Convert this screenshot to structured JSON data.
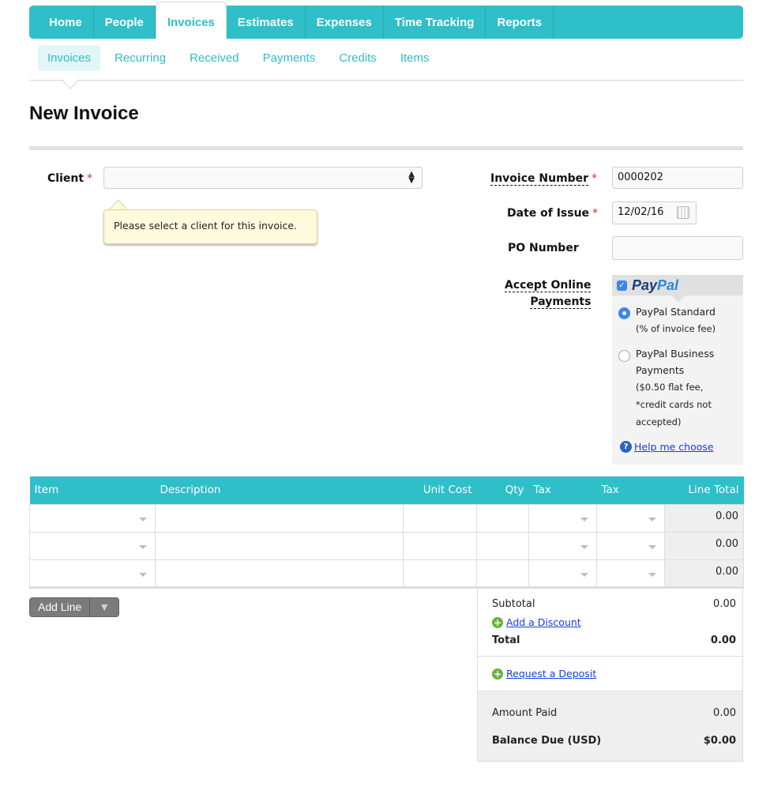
{
  "nav": {
    "tabs": [
      {
        "label": "Home",
        "active": false
      },
      {
        "label": "People",
        "active": false
      },
      {
        "label": "Invoices",
        "active": true
      },
      {
        "label": "Estimates",
        "active": false
      },
      {
        "label": "Expenses",
        "active": false
      },
      {
        "label": "Time Tracking",
        "active": false
      },
      {
        "label": "Reports",
        "active": false
      }
    ],
    "subtabs": [
      {
        "label": "Invoices",
        "active": true
      },
      {
        "label": "Recurring",
        "active": false
      },
      {
        "label": "Received",
        "active": false
      },
      {
        "label": "Payments",
        "active": false
      },
      {
        "label": "Credits",
        "active": false
      },
      {
        "label": "Items",
        "active": false
      }
    ]
  },
  "page": {
    "title": "New Invoice"
  },
  "form": {
    "client_label": "Client",
    "required_mark": "*",
    "client_value": "",
    "client_tooltip": "Please select a client for this invoice.",
    "invoice_number_label": "Invoice Number",
    "invoice_number_value": "0000202",
    "date_label": "Date of Issue",
    "date_value": "12/02/16",
    "po_label": "PO Number",
    "po_value": "",
    "online_label_1": "Accept Online",
    "online_label_2": "Payments"
  },
  "paypal": {
    "checked": true,
    "logo_1": "Pay",
    "logo_2": "Pal",
    "options": [
      {
        "lines": [
          "PayPal Standard",
          "(% of invoice fee)"
        ],
        "selected": true
      },
      {
        "lines": [
          "PayPal Business",
          "Payments",
          "($0.50 flat fee,",
          "*credit cards not",
          "accepted)"
        ],
        "selected": false
      }
    ],
    "help_link": "Help me choose"
  },
  "table": {
    "headers": [
      "Item",
      "Description",
      "Unit Cost",
      "Qty",
      "Tax",
      "Tax",
      "Line Total"
    ],
    "rows": [
      {
        "item": "",
        "description": "",
        "unit_cost": "",
        "qty": "",
        "tax1": "",
        "tax2": "",
        "line_total": "0.00"
      },
      {
        "item": "",
        "description": "",
        "unit_cost": "",
        "qty": "",
        "tax1": "",
        "tax2": "",
        "line_total": "0.00"
      },
      {
        "item": "",
        "description": "",
        "unit_cost": "",
        "qty": "",
        "tax1": "",
        "tax2": "",
        "line_total": "0.00"
      }
    ],
    "add_line": "Add Line"
  },
  "totals": {
    "subtotal_label": "Subtotal",
    "subtotal_value": "0.00",
    "add_discount": "Add a Discount",
    "total_label": "Total",
    "total_value": "0.00",
    "request_deposit": "Request a Deposit",
    "amount_paid_label": "Amount Paid",
    "amount_paid_value": "0.00",
    "balance_due_label": "Balance Due (USD)",
    "balance_due_value": "$0.00"
  }
}
